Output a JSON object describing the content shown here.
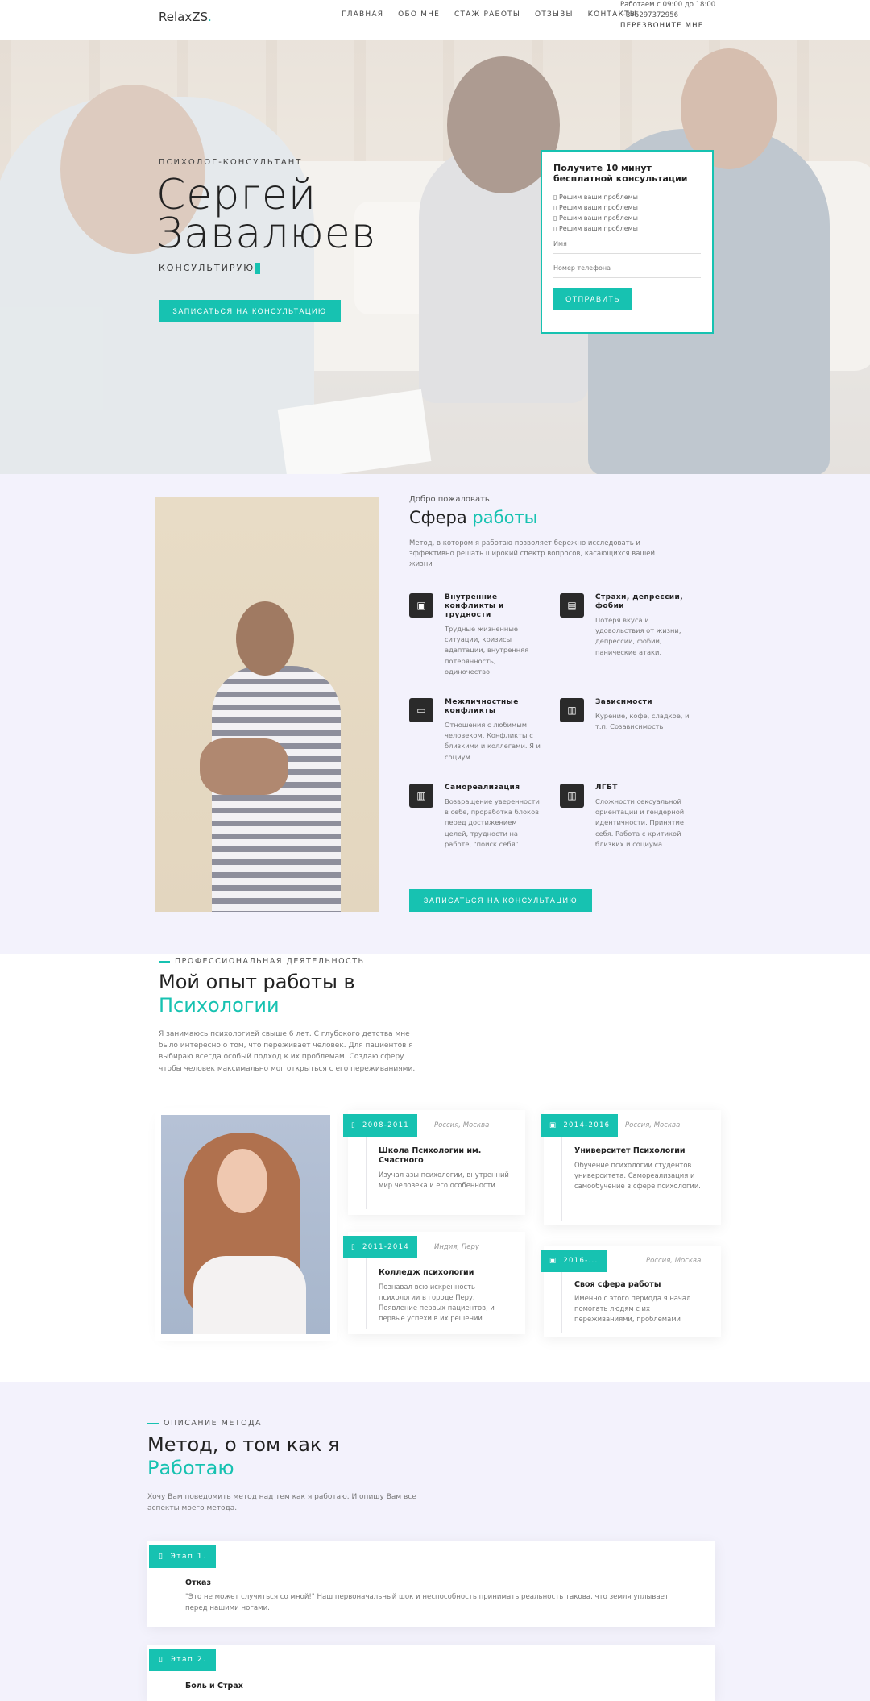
{
  "header": {
    "logo": "RelaxZS",
    "logo_dot": ".",
    "nav": [
      "ГЛАВНАЯ",
      "ОБО МНЕ",
      "СТАЖ РАБОТЫ",
      "ОТЗЫВЫ",
      "КОНТАКТЫ"
    ],
    "hours": "Работаем с 09:00 до 18:00",
    "phone": "+375297372956",
    "callback": "ПЕРЕЗВОНИТЕ МНЕ"
  },
  "hero": {
    "subtitle": "ПСИХОЛОГ-КОНСУЛЬТАНТ",
    "name_first": "Сергей",
    "name_last": "Завалюев",
    "tagline": "КОНСУЛЬТИРУЮ",
    "button": "ЗАПИСАТЬСЯ НА КОНСУЛЬТАЦИЮ",
    "form": {
      "title": "Получите 10 минут бесплатной консультации",
      "items": [
        "Решим ваши проблемы",
        "Решим ваши проблемы",
        "Решим ваши проблемы",
        "Решим ваши проблемы"
      ],
      "name_placeholder": "Имя",
      "phone_placeholder": "Номер телефона",
      "submit": "ОТПРАВИТЬ"
    }
  },
  "scope": {
    "welcome": "Добро пожаловать",
    "title_a": "Сфера ",
    "title_b": "работы",
    "description": "Метод, в котором я работаю позволяет бережно исследовать и эффективно решать широкий спектр вопросов, касающихся вашей жизни",
    "features": [
      {
        "title": "Внутренние конфликты и трудности",
        "text": "Трудные жизненные ситуации, кризисы адаптации, внутренняя потерянность, одиночество.",
        "icon": "image-icon"
      },
      {
        "title": "Страхи, депрессии, фобии",
        "text": "Потеря вкуса и удовольствия от жизни, депрессии, фобии, панические атаки.",
        "icon": "layout-icon"
      },
      {
        "title": "Межличностные конфликты",
        "text": "Отношения с любимым человеком. Конфликты с близкими и коллегами. Я и социум",
        "icon": "wallet-icon"
      },
      {
        "title": "Зависимости",
        "text": "Курение, кофе, сладкое, и т.п. Созависимость",
        "icon": "books-icon"
      },
      {
        "title": "Самореализация",
        "text": "Возвращение уверенности в себе, проработка блоков перед достижением целей, трудности на работе, \"поиск себя\".",
        "icon": "books-icon"
      },
      {
        "title": "ЛГБТ",
        "text": "Сложности сексуальной ориентации и гендерной идентичности. Принятие себя. Работа с критикой близких и социума.",
        "icon": "books-icon"
      }
    ],
    "button": "ЗАПИСАТЬСЯ НА КОНСУЛЬТАЦИЮ"
  },
  "experience": {
    "eyebrow": "ПРОФЕССИОНАЛЬНАЯ ДЕЯТЕЛЬНОСТЬ",
    "title_a": "Мой опыт работы в",
    "title_b": "Психологии",
    "description": "Я занимаюсь психологией свыше 6 лет. С глубокого детства мне было интересно о том, что переживает человек. Для пациентов я выбираю всегда особый подход к их проблемам. Создаю сферу чтобы человек максимально мог открыться с его переживаниями.",
    "timeline": [
      {
        "years": "2008-2011",
        "location": "Россия, Москва",
        "title": "Школа Психологии им. Счастного",
        "text": "Изучал азы психологии, внутренний мир человека и его особенности",
        "icon": "book-icon"
      },
      {
        "years": "2014-2016",
        "location": "Россия, Москва",
        "title": "Университет Психологии",
        "text": "Обучение психологии студентов университета. Самореализация и самообучение в сфере психологии.",
        "icon": "briefcase-icon"
      },
      {
        "years": "2011-2014",
        "location": "Индия, Перу",
        "title": "Колледж психологии",
        "text": "Познавал всю искренность психологии в городе Перу. Появление первых пациентов, и первые успехи в их решении",
        "icon": "book-icon"
      },
      {
        "years": "2016-...",
        "location": "Россия, Москва",
        "title": "Своя сфера работы",
        "text": "Именно с этого периода я начал помогать людям с их переживаниями, проблемами",
        "icon": "briefcase-icon"
      }
    ]
  },
  "method": {
    "eyebrow": "ОПИСАНИЕ МЕТОДА",
    "title_a": "Метод, о том как я",
    "title_b": "Работаю",
    "description": "Хочу Вам поведомить метод над тем как я работаю. И опишу Вам все аспекты моего метода.",
    "steps": [
      {
        "tag": "Этап 1.",
        "title": "Отказ",
        "text": "\"Это не может случиться со мной!\" Наш первоначальный шок и неспособность принимать реальность такова, что земля уплывает перед нашими ногами."
      },
      {
        "tag": "Этап 2.",
        "title": "Боль и Страх",
        "text": ""
      }
    ]
  }
}
